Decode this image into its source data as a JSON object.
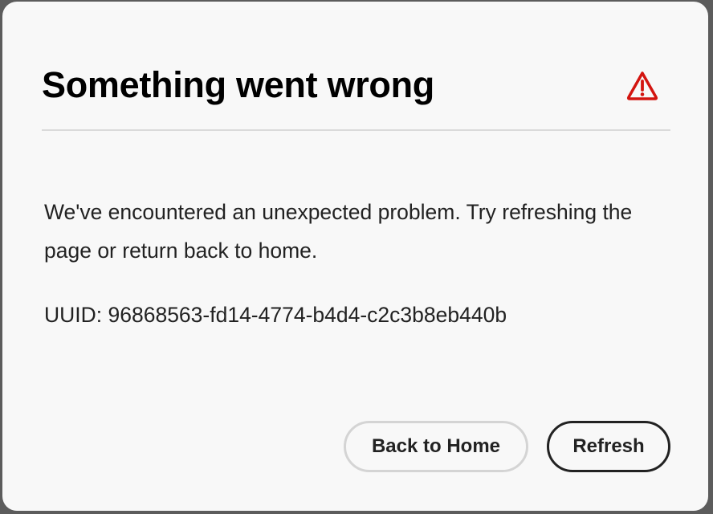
{
  "dialog": {
    "title": "Something went wrong",
    "icon": "alert-triangle-icon",
    "message": "We've encountered an unexpected problem. Try refreshing the page or return back to home.",
    "uuid": "UUID: 96868563-fd14-4774-b4d4-c2c3b8eb440b",
    "buttons": {
      "secondary_label": "Back to Home",
      "primary_label": "Refresh"
    }
  },
  "colors": {
    "alert": "#d31510",
    "background": "#f8f8f8",
    "overlay": "#5c5c5c"
  }
}
